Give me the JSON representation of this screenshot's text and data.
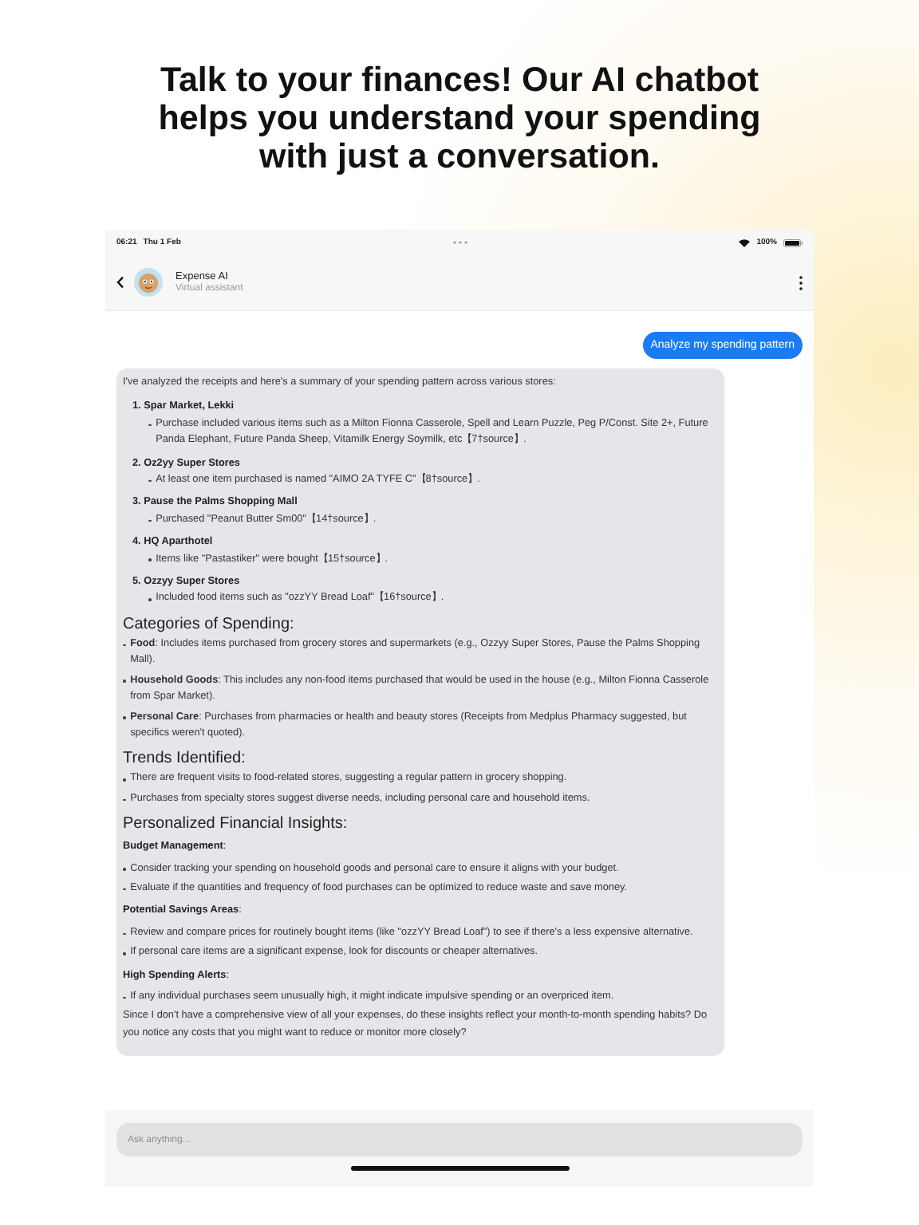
{
  "headline": "Talk to your finances! Our AI chatbot helps you understand your spending with just a conversation.",
  "status_bar": {
    "time": "06:21",
    "date": "Thu 1 Feb",
    "battery": "100%"
  },
  "header": {
    "title": "Expense AI",
    "subtitle": "Virtual assistant"
  },
  "messages": [
    {
      "kind": "user",
      "text": "Analyze my spending pattern"
    },
    {
      "kind": "assistant",
      "blocks": [
        {
          "kind": "paragraph",
          "text": "I've analyzed the receipts and here's a summary of your spending pattern across various stores:"
        },
        {
          "kind": "numbered",
          "items": [
            {
              "title": "1. Spar Market, Lekki",
              "bullets": [
                "Purchase included various items such as a Milton Fionna Casserole, Spell and Learn Puzzle, Peg P/Const. Site 2+, Future Panda Elephant, Future Panda Sheep, Vitamilk Energy Soymilk, etc【7†source】."
              ]
            },
            {
              "title": "2. Oz2yy Super Stores",
              "bullets": [
                "At least one item purchased is named \"AIMO 2A TYFE C\"【8†source】."
              ]
            },
            {
              "title": "3. Pause the Palms Shopping Mall",
              "bullets": [
                "Purchased \"Peanut Butter Sm00\"【14†source】."
              ]
            },
            {
              "title": "4. HQ Aparthotel",
              "bullets": [
                "Items like \"Pastastiker\" were bought【15†source】."
              ]
            },
            {
              "title": "5. Ozzyy Super Stores",
              "bullets": [
                "Included food items such as \"ozzYY Bread Loaf\"【16†source】."
              ]
            }
          ]
        },
        {
          "kind": "heading",
          "text": "Categories of Spending:"
        },
        {
          "kind": "bullets",
          "items": [
            "**Food**: Includes items purchased from grocery stores and supermarkets (e.g., Ozzyy Super Stores, Pause the Palms Shopping Mall).",
            "**Household Goods**: This includes any non-food items purchased that would be used in the house (e.g., Milton Fionna Casserole from Spar Market).",
            "**Personal Care**: Purchases from pharmacies or health and beauty stores (Receipts from Medplus Pharmacy suggested, but specifics weren't quoted)."
          ]
        },
        {
          "kind": "heading",
          "text": "Trends Identified:"
        },
        {
          "kind": "bullets",
          "items": [
            "There are frequent visits to food-related stores, suggesting a regular pattern in grocery shopping.",
            "Purchases from specialty stores suggest diverse needs, including personal care and household items."
          ]
        },
        {
          "kind": "heading",
          "text": "Personalized Financial Insights:"
        },
        {
          "kind": "subheading",
          "text": "**Budget Management**:"
        },
        {
          "kind": "bullets",
          "items": [
            "Consider tracking your spending on household goods and personal care to ensure it aligns with your budget.",
            "Evaluate if the quantities and frequency of food purchases can be optimized to reduce waste and save money."
          ]
        },
        {
          "kind": "subheading",
          "text": "**Potential Savings Areas**:"
        },
        {
          "kind": "bullets",
          "items": [
            "Review and compare prices for routinely bought items (like \"ozzYY Bread Loaf\") to see if there's a less expensive alternative.",
            "If personal care items are a significant expense, look for discounts or cheaper alternatives."
          ]
        },
        {
          "kind": "subheading",
          "text": "**High Spending Alerts**:"
        },
        {
          "kind": "bullets",
          "items": [
            "If any individual purchases seem unusually high, it might indicate impulsive spending or an overpriced item."
          ]
        },
        {
          "kind": "paragraph",
          "text": "Since I don't have a comprehensive view of all your expenses, do these insights reflect your month-to-month spending habits? Do you notice any costs that you might want to reduce or monitor more closely?"
        }
      ]
    }
  ],
  "input": {
    "placeholder": "Ask anything..."
  }
}
